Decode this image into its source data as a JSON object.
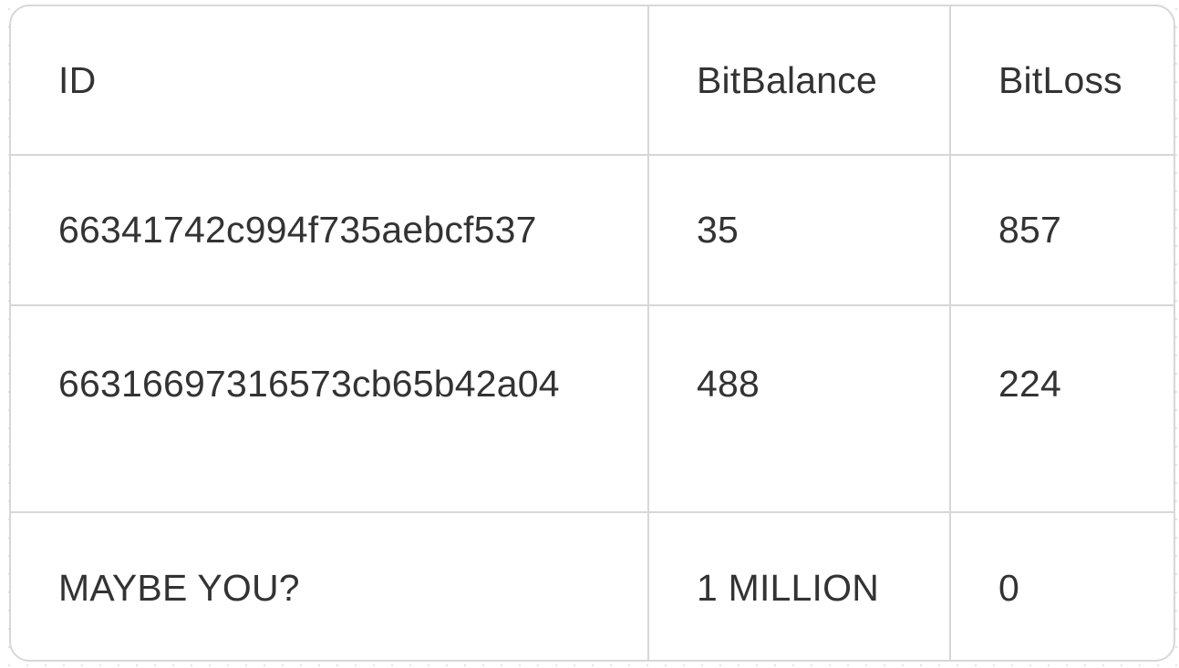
{
  "table": {
    "columns": [
      "ID",
      "BitBalance",
      "BitLoss"
    ],
    "rows": [
      {
        "id": "66341742c994f735aebcf537",
        "bit_balance": "35",
        "bit_loss": "857"
      },
      {
        "id": "66316697316573cb65b42a04",
        "bit_balance": "488",
        "bit_loss": "224"
      },
      {
        "id": "MAYBE YOU?",
        "bit_balance": "1 MILLION",
        "bit_loss": "0"
      }
    ]
  }
}
